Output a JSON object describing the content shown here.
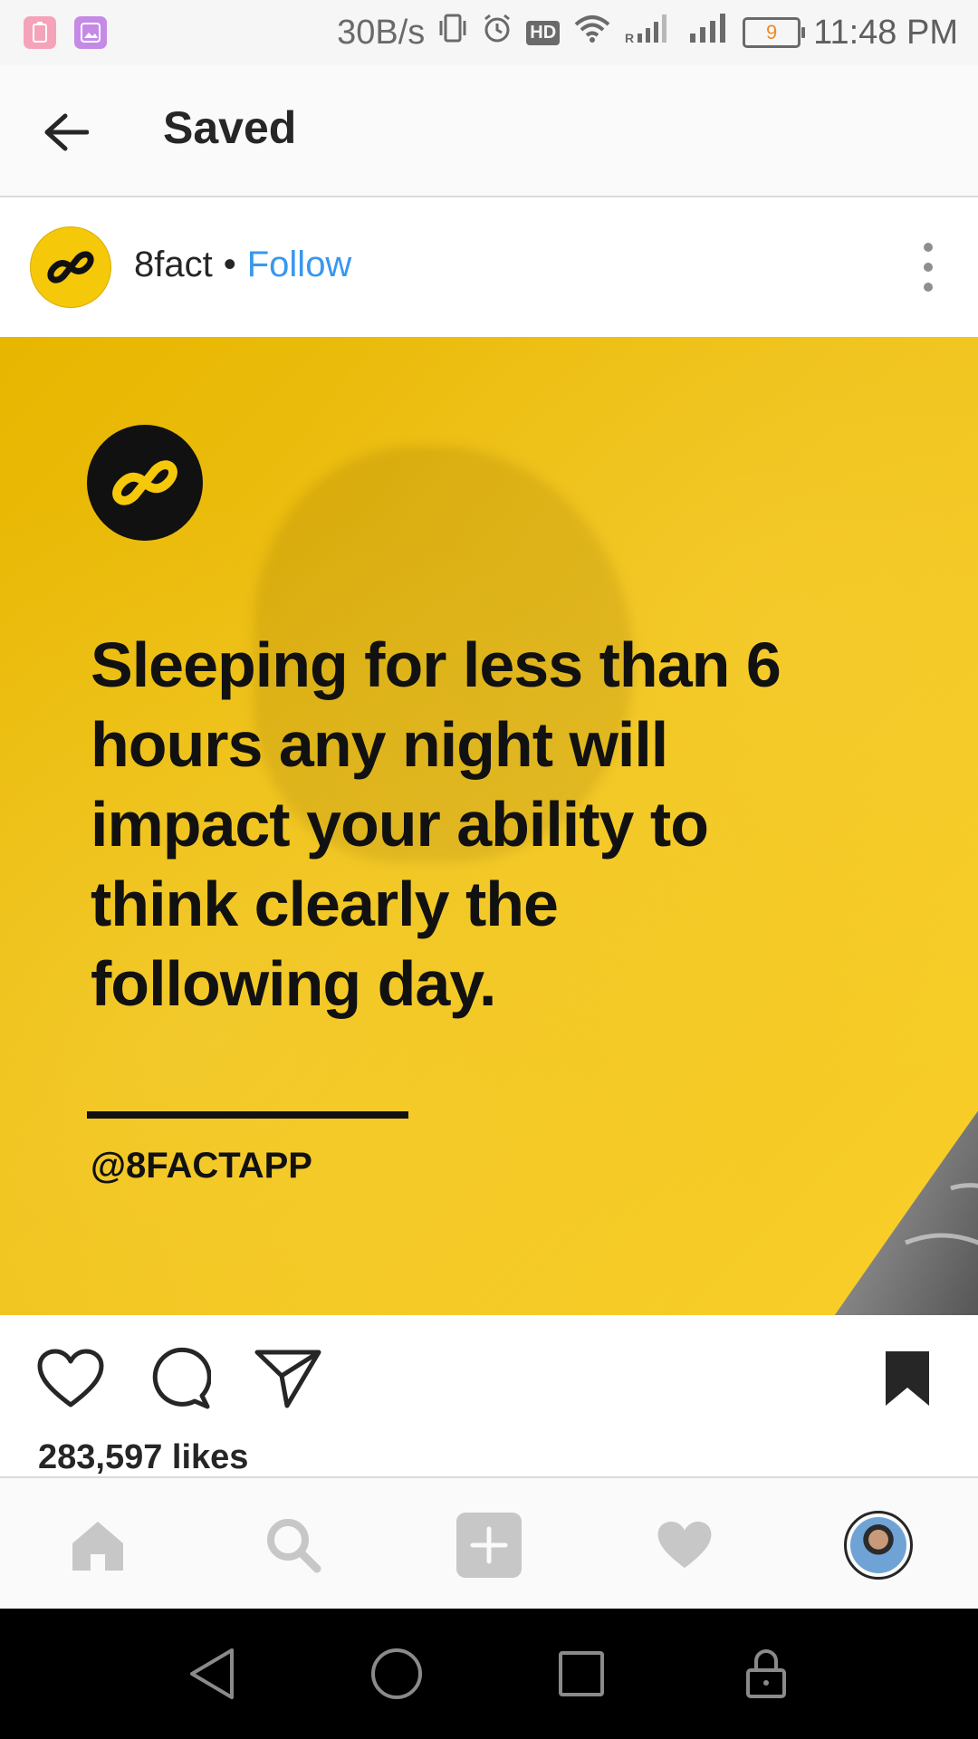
{
  "status_bar": {
    "net_speed": "30B/s",
    "hd": "HD",
    "battery_level": "9",
    "time": "11:48 PM"
  },
  "nav": {
    "title": "Saved"
  },
  "post": {
    "username": "8fact",
    "separator": "•",
    "follow_label": "Follow",
    "image": {
      "fact_text": "Sleeping for less than 6 hours any night will impact your ability to think clearly the following day.",
      "handle": "@8FACTAPP"
    },
    "likes": "283,597 likes"
  },
  "colors": {
    "brand_yellow": "#f6c80a",
    "follow_blue": "#3897f0"
  },
  "icons": {
    "back": "arrow-left-icon",
    "more": "more-vertical-icon",
    "like": "heart-outline-icon",
    "comment": "comment-icon",
    "share": "send-icon",
    "save": "bookmark-filled-icon",
    "home": "home-icon",
    "search": "search-icon",
    "add": "add-post-icon",
    "activity": "heart-filled-icon",
    "profile": "profile-avatar"
  }
}
